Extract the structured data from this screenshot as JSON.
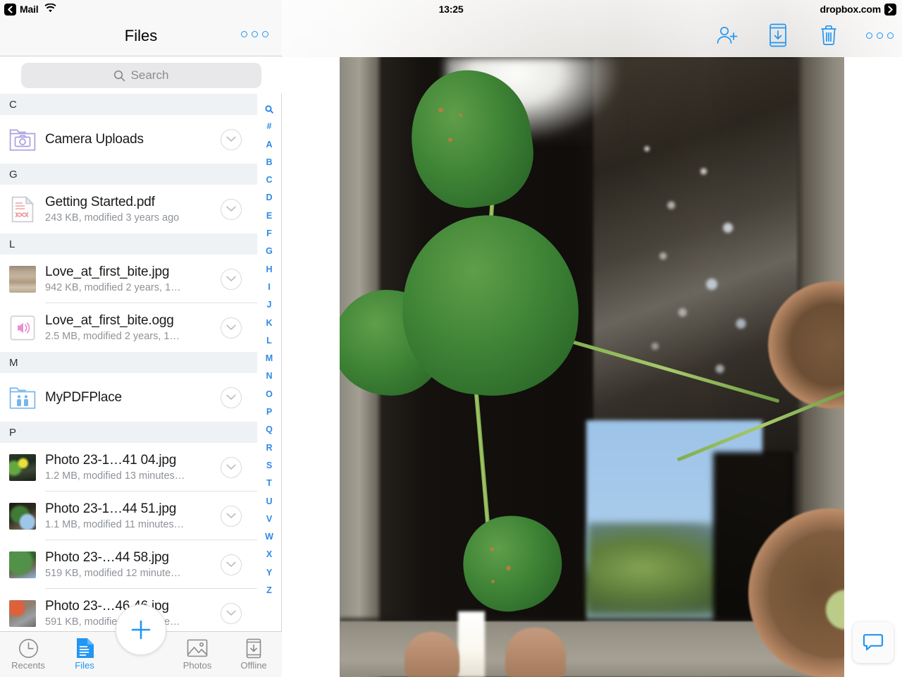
{
  "statusbar": {
    "back_app": "Mail",
    "wifi_icon": "wifi-icon",
    "time": "13:25",
    "return_app": "dropbox.com"
  },
  "sidebar": {
    "title": "Files",
    "more_icon": "more-horizontal-icon",
    "search": {
      "placeholder": "Search",
      "icon": "search-icon"
    },
    "sections": [
      {
        "letter": "C",
        "items": [
          {
            "name": "Camera Uploads",
            "meta": "",
            "icon": "camera-folder-icon",
            "kind": "folder"
          }
        ]
      },
      {
        "letter": "G",
        "items": [
          {
            "name": "Getting Started.pdf",
            "meta": "243 KB, modified 3 years ago",
            "icon": "pdf-file-icon",
            "kind": "file"
          }
        ]
      },
      {
        "letter": "L",
        "items": [
          {
            "name": "Love_at_first_bite.jpg",
            "meta": "942 KB, modified 2 years, 1…",
            "icon": "image-thumbnail",
            "kind": "image"
          },
          {
            "name": "Love_at_first_bite.ogg",
            "meta": "2.5 MB, modified 2 years, 1…",
            "icon": "audio-file-icon",
            "kind": "file"
          }
        ]
      },
      {
        "letter": "M",
        "items": [
          {
            "name": "MyPDFPlace",
            "meta": "",
            "icon": "shared-folder-icon",
            "kind": "folder"
          }
        ]
      },
      {
        "letter": "P",
        "items": [
          {
            "name": "Photo 23-1…41 04.jpg",
            "meta": "1.2 MB, modified 13 minutes…",
            "icon": "image-thumbnail",
            "kind": "image"
          },
          {
            "name": "Photo 23-1…44 51.jpg",
            "meta": "1.1 MB, modified 11 minutes…",
            "icon": "image-thumbnail",
            "kind": "image"
          },
          {
            "name": "Photo 23-…44 58.jpg",
            "meta": "519 KB, modified 12 minute…",
            "icon": "image-thumbnail",
            "kind": "image"
          },
          {
            "name": "Photo 23-…46 46.jpg",
            "meta": "591 KB, modified 11 minute…",
            "icon": "image-thumbnail",
            "kind": "image"
          }
        ]
      }
    ],
    "alpha_index": [
      "search-icon",
      "#",
      "A",
      "B",
      "C",
      "D",
      "E",
      "F",
      "G",
      "H",
      "I",
      "J",
      "K",
      "L",
      "M",
      "N",
      "O",
      "P",
      "Q",
      "R",
      "S",
      "T",
      "U",
      "V",
      "W",
      "X",
      "Y",
      "Z"
    ]
  },
  "tabbar": {
    "tabs": [
      {
        "label": "Recents",
        "icon": "clock-icon",
        "active": false
      },
      {
        "label": "Files",
        "icon": "document-icon",
        "active": true
      },
      {
        "label": "Photos",
        "icon": "photo-icon",
        "active": false
      },
      {
        "label": "Offline",
        "icon": "offline-download-icon",
        "active": false
      }
    ],
    "fab": {
      "icon": "plus-icon",
      "label": ""
    }
  },
  "detail": {
    "toolbar_actions": [
      {
        "name": "share-add-person",
        "icon": "person-add-icon"
      },
      {
        "name": "save-to-device",
        "icon": "device-download-icon"
      },
      {
        "name": "delete",
        "icon": "trash-icon"
      },
      {
        "name": "more",
        "icon": "more-horizontal-icon"
      }
    ],
    "chat_button": {
      "icon": "chat-bubble-icon"
    },
    "preview": "photo-preview-pond-taro-leaves"
  },
  "colors": {
    "accent": "#2196f3",
    "index_blue": "#2e8ae6",
    "section_bg": "#eff2f5",
    "meta_text": "#8e9399",
    "toolbar_bg": "#f8f8f8"
  }
}
